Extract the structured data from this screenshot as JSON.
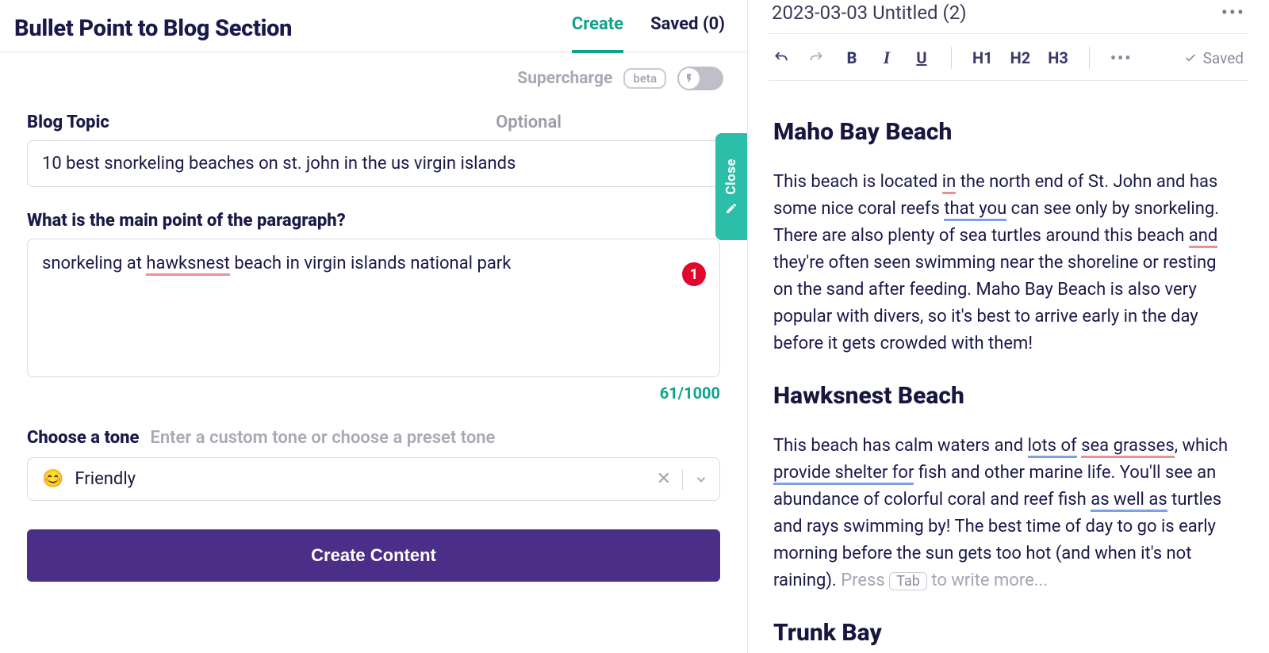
{
  "header": {
    "title": "Bullet Point to Blog Section",
    "tabs": {
      "create": "Create",
      "saved": "Saved (0)"
    }
  },
  "supercharge": {
    "label": "Supercharge",
    "badge": "beta"
  },
  "form": {
    "blog_topic_label": "Blog Topic",
    "optional": "Optional",
    "blog_topic_value": "10 best snorkeling beaches on st. john in the us virgin islands",
    "main_point_label": "What is the main point of the paragraph?",
    "main_point_prefix": "snorkeling at ",
    "main_point_spell": "hawksnest",
    "main_point_suffix": " beach in virgin islands national park",
    "error_count": "1",
    "char_count": "61/1000",
    "tone_label": "Choose a tone",
    "tone_placeholder": "Enter a custom tone or choose a preset tone",
    "tone_emoji": "😊",
    "tone_value": "Friendly",
    "create_button": "Create Content"
  },
  "close_panel": {
    "label": "Close"
  },
  "doc": {
    "title": "2023-03-03 Untitled (2)",
    "saved_status": "Saved"
  },
  "toolbar": {
    "bold": "B",
    "italic": "I",
    "underline": "U",
    "h1": "H1",
    "h2": "H2",
    "h3": "H3"
  },
  "editor": {
    "sections": [
      {
        "heading": "Maho Bay Beach",
        "runs": [
          {
            "t": "This beach is located "
          },
          {
            "t": "in",
            "u": "spell"
          },
          {
            "t": " the north end of St. John and has some nice coral reefs "
          },
          {
            "t": "that you",
            "u": "grammar"
          },
          {
            "t": " can see only by snorkeling. There are also plenty of sea turtles around this beach "
          },
          {
            "t": "and",
            "u": "spell"
          },
          {
            "t": " they're often seen swimming near the shoreline or resting on the sand after feeding. Maho Bay Beach is also very popular with divers, so it's best to arrive early in the day before it gets crowded with them!"
          }
        ]
      },
      {
        "heading": "Hawksnest Beach",
        "runs": [
          {
            "t": "This beach has calm waters and "
          },
          {
            "t": "lots of",
            "u": "grammar"
          },
          {
            "t": " "
          },
          {
            "t": "sea grasses",
            "u": "spell"
          },
          {
            "t": ", which "
          },
          {
            "t": "provide shelter for",
            "u": "grammar"
          },
          {
            "t": " fish and other marine life. You'll see an abundance of colorful coral and reef fish "
          },
          {
            "t": "as well as",
            "u": "grammar"
          },
          {
            "t": " turtles and rays swimming by! The best time of day to go is early morning before the sun gets too hot (and when it's not raining). "
          }
        ],
        "ghost_prefix": "Press ",
        "ghost_kbd": "Tab",
        "ghost_suffix": " to write more..."
      },
      {
        "heading": "Trunk Bay"
      }
    ]
  }
}
